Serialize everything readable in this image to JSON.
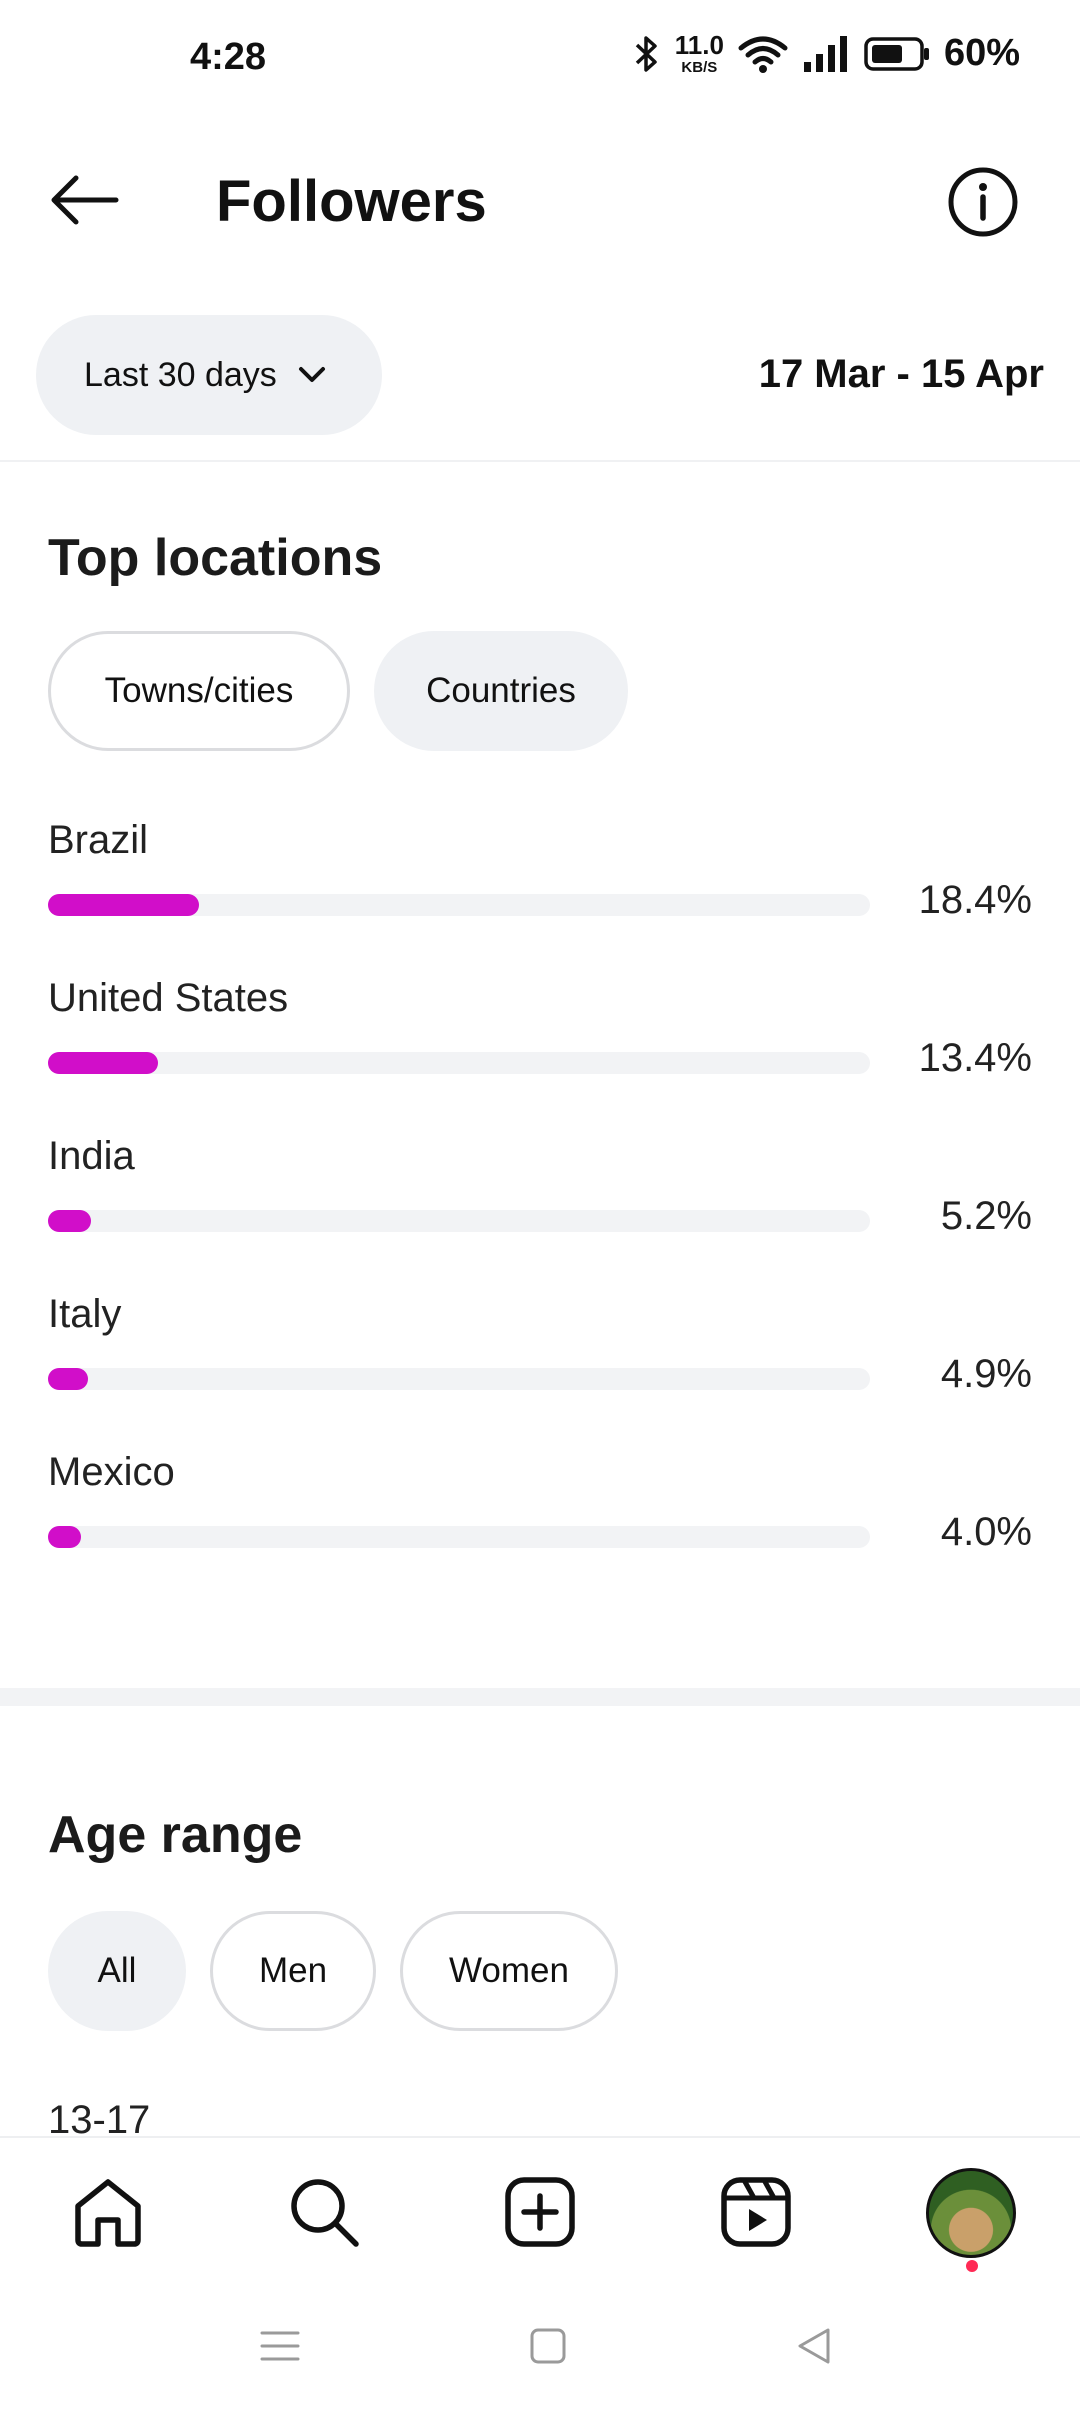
{
  "status_bar": {
    "time": "4:28",
    "net_speed_value": "11.0",
    "net_speed_unit": "KB/S",
    "battery_percent": "60%",
    "battery_level": 0.6
  },
  "header": {
    "title": "Followers",
    "back_icon": "arrow-left-icon",
    "info_icon": "info-icon"
  },
  "filter": {
    "range_label": "Last 30 days",
    "date_range": "17 Mar - 15 Apr"
  },
  "top_locations": {
    "title": "Top locations",
    "tabs": [
      {
        "label": "Towns/cities",
        "selected": false
      },
      {
        "label": "Countries",
        "selected": true
      }
    ],
    "items": [
      {
        "name": "Brazil",
        "percent_label": "18.4%",
        "value": 18.4
      },
      {
        "name": "United States",
        "percent_label": "13.4%",
        "value": 13.4
      },
      {
        "name": "India",
        "percent_label": "5.2%",
        "value": 5.2
      },
      {
        "name": "Italy",
        "percent_label": "4.9%",
        "value": 4.9
      },
      {
        "name": "Mexico",
        "percent_label": "4.0%",
        "value": 4.0
      }
    ]
  },
  "age_range": {
    "title": "Age range",
    "tabs": [
      {
        "label": "All",
        "selected": true
      },
      {
        "label": "Men",
        "selected": false
      },
      {
        "label": "Women",
        "selected": false
      }
    ],
    "first_row_label": "13-17"
  },
  "bottom_nav": {
    "items": [
      "home-icon",
      "search-icon",
      "create-icon",
      "reels-icon",
      "profile-avatar"
    ]
  },
  "colors": {
    "accent_bar": "#d10ec9",
    "track": "#f2f3f5",
    "chip_fill": "#eff1f4",
    "notification_dot": "#ff2a55"
  }
}
